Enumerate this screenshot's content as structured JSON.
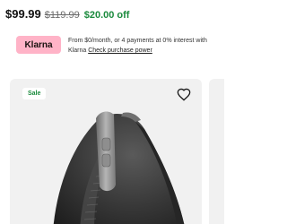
{
  "price": {
    "current": "$99.99",
    "original": "$119.99",
    "savings": "$20.00 off"
  },
  "klarna": {
    "logo_text": "Klarna",
    "text": "From $0/month, or 4 payments at 0% interest with Klarna",
    "link_label": "Check purchase power",
    "brand_color": "#ffb3c7"
  },
  "product_card": {
    "badge": "Sale",
    "favorite_icon": "heart-icon",
    "image_subject": "ergonomic vertical mouse"
  },
  "colors": {
    "savings_green": "#1a8a3c",
    "card_background": "#f1f1f1"
  }
}
